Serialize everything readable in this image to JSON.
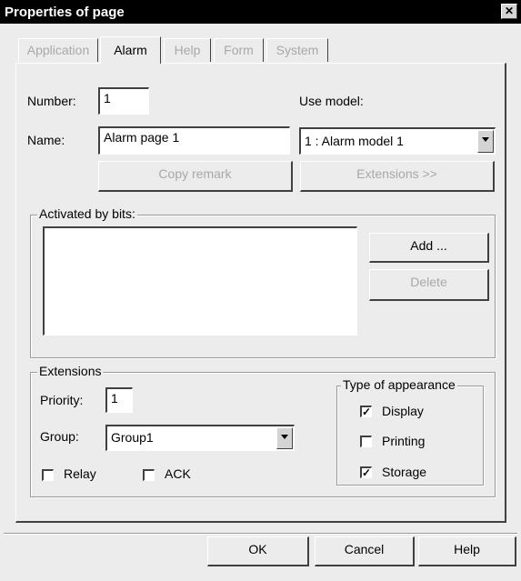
{
  "window": {
    "title": "Properties of page",
    "close_glyph": "✕"
  },
  "tabs": [
    {
      "label": "Application",
      "active": false,
      "disabled": true
    },
    {
      "label": "Alarm",
      "active": true,
      "disabled": false
    },
    {
      "label": "Help",
      "active": false,
      "disabled": true
    },
    {
      "label": "Form",
      "active": false,
      "disabled": true
    },
    {
      "label": "System",
      "active": false,
      "disabled": true
    }
  ],
  "alarm": {
    "number_label": "Number:",
    "number_value": "1",
    "name_label": "Name:",
    "name_value": "Alarm page 1",
    "use_model_label": "Use model:",
    "use_model_value": "1 : Alarm model 1",
    "copy_remark_label": "Copy remark",
    "extensions_button_label": "Extensions >>"
  },
  "activated_by_bits": {
    "legend": "Activated by bits:",
    "items": [],
    "add_label": "Add ...",
    "delete_label": "Delete"
  },
  "extensions": {
    "legend": "Extensions",
    "priority_label": "Priority:",
    "priority_value": "1",
    "group_label": "Group:",
    "group_value": "Group1",
    "relay_label": "Relay",
    "relay_checked": false,
    "ack_label": "ACK",
    "ack_checked": false
  },
  "appearance": {
    "legend": "Type of appearance",
    "display_label": "Display",
    "display_checked": true,
    "printing_label": "Printing",
    "printing_checked": false,
    "storage_label": "Storage",
    "storage_checked": true
  },
  "footer": {
    "ok_label": "OK",
    "cancel_label": "Cancel",
    "help_label": "Help"
  },
  "check_glyph": "✓"
}
